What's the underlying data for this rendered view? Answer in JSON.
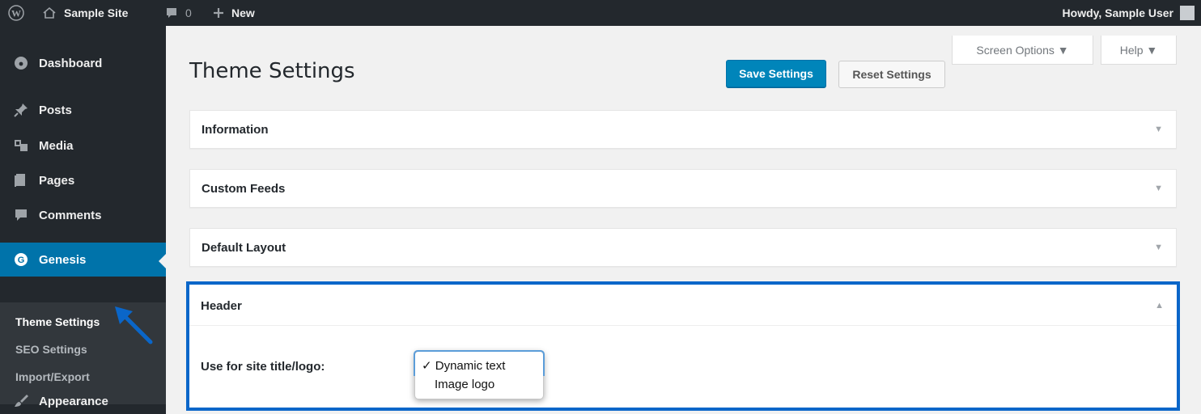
{
  "adminbar": {
    "site_name": "Sample Site",
    "comments_count": "0",
    "new_label": "New",
    "howdy": "Howdy, Sample User"
  },
  "sidebar": {
    "items": [
      {
        "label": "Dashboard",
        "icon": "dashboard-icon"
      },
      {
        "label": "Posts",
        "icon": "pin-icon"
      },
      {
        "label": "Media",
        "icon": "media-icon"
      },
      {
        "label": "Pages",
        "icon": "pages-icon"
      },
      {
        "label": "Comments",
        "icon": "comment-icon"
      },
      {
        "label": "Genesis",
        "icon": "genesis-icon"
      },
      {
        "label": "Appearance",
        "icon": "brush-icon"
      }
    ],
    "submenu": [
      "Theme Settings",
      "SEO Settings",
      "Import/Export"
    ]
  },
  "main": {
    "title": "Theme Settings",
    "save_label": "Save Settings",
    "reset_label": "Reset Settings",
    "screen_options": "Screen Options ▼",
    "help": "Help ▼",
    "boxes": [
      "Information",
      "Custom Feeds",
      "Default Layout",
      "Header"
    ],
    "header": {
      "field_label": "Use for site title/logo:",
      "options": [
        "✓ Dynamic text",
        "Image logo"
      ]
    }
  },
  "colors": {
    "adminbar": "#23282d",
    "accent": "#0073aa",
    "highlight_border": "#0a66c9",
    "background": "#f1f1f1"
  }
}
